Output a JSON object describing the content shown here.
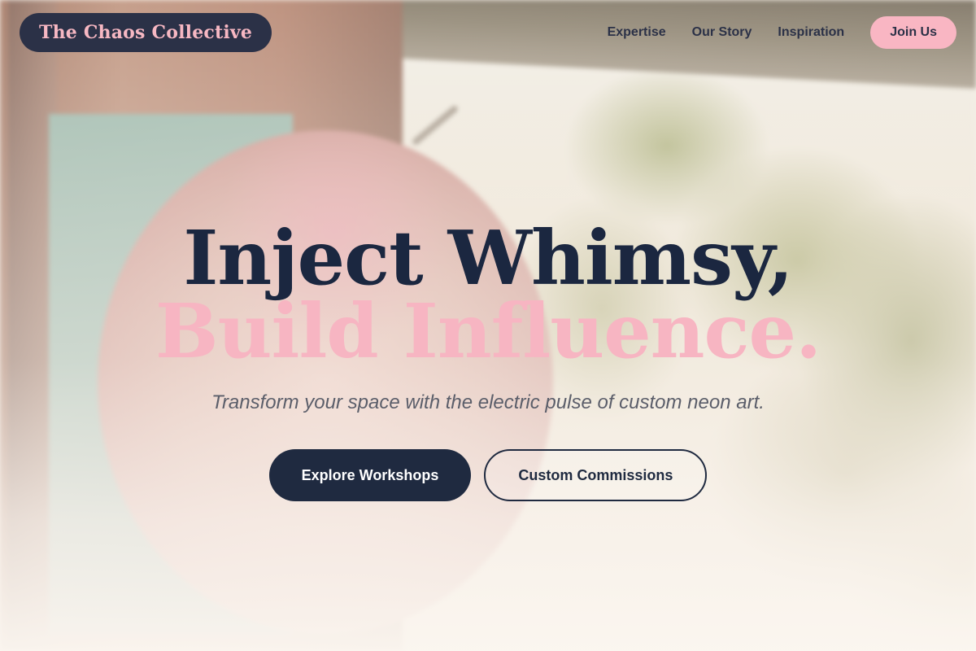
{
  "brand": {
    "name": "The Chaos Collective"
  },
  "nav": {
    "links": [
      {
        "label": "Expertise"
      },
      {
        "label": "Our Story"
      },
      {
        "label": "Inspiration"
      }
    ],
    "cta_label": "Join Us"
  },
  "hero": {
    "headline_line1": "Inject Whimsy,",
    "headline_line2": "Build Influence.",
    "tagline": "Transform your space with the electric pulse of custom neon art.",
    "primary_button": "Explore Workshops",
    "secondary_button": "Custom Commissions"
  },
  "colors": {
    "navy": "#1f2a40",
    "pink": "#f7b5c2",
    "cream": "#fbf6f0"
  }
}
